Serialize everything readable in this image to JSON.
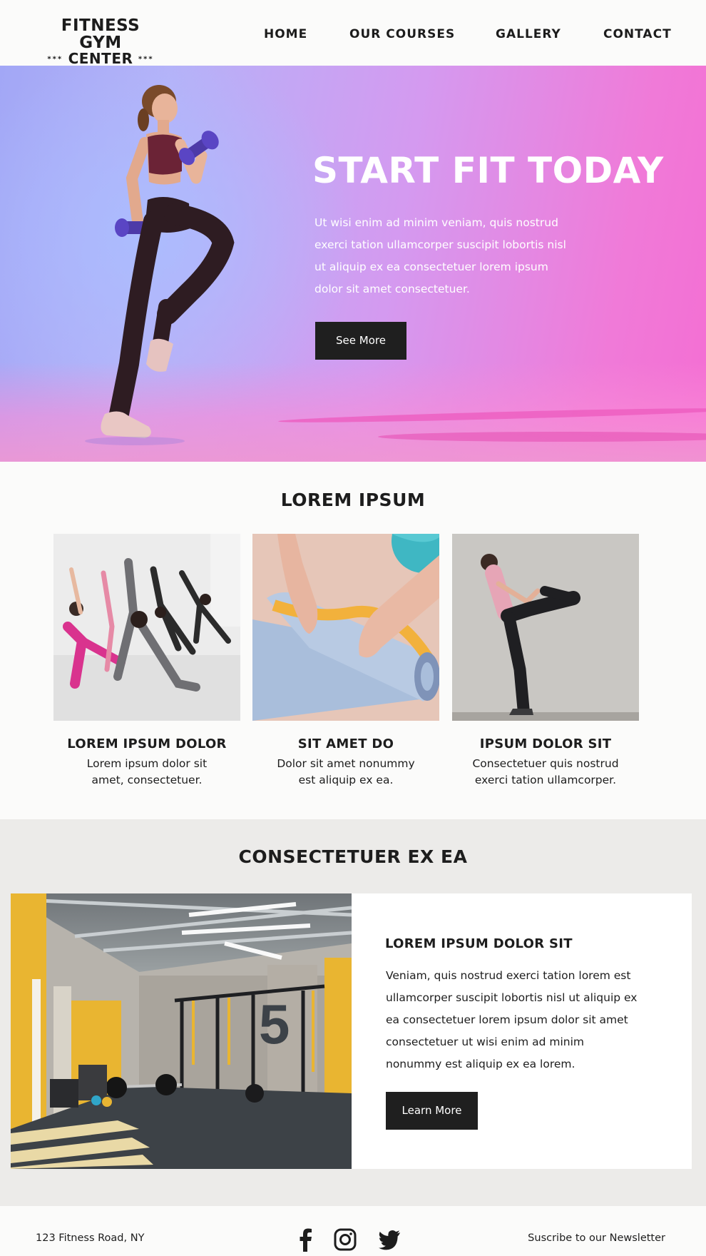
{
  "header": {
    "logo": {
      "line1": "FITNESS GYM",
      "stars": "***",
      "line2": "CENTER"
    },
    "nav": [
      "HOME",
      "OUR COURSES",
      "GALLERY",
      "CONTACT"
    ]
  },
  "hero": {
    "title": "START FIT TODAY",
    "text": "Ut wisi enim ad minim veniam, quis nostrud exerci tation ullamcorper suscipit lobortis nisl ut aliquip ex ea consectetuer lorem ipsum dolor sit amet consectetuer.",
    "button": "See More"
  },
  "features": {
    "title": "LOREM IPSUM",
    "cards": [
      {
        "title": "LOREM IPSUM DOLOR",
        "text": "Lorem ipsum dolor sit amet, consectetuer."
      },
      {
        "title": "SIT AMET DO",
        "text": "Dolor sit amet nonummy est aliquip ex ea."
      },
      {
        "title": "IPSUM DOLOR SIT",
        "text": "Consectetuer quis nostrud exerci tation ullamcorper."
      }
    ]
  },
  "promo": {
    "title": "CONSECTETUER EX EA",
    "heading": "LOREM IPSUM DOLOR SIT",
    "text": "Veniam, quis nostrud exerci tation lorem est ullamcorper suscipit lobortis nisl ut aliquip ex ea consectetuer lorem ipsum dolor sit amet consectetuer ut wisi enim ad minim nonummy est aliquip ex ea lorem.",
    "button": "Learn More",
    "gym_number": "5"
  },
  "footer": {
    "address": "123 Fitness Road, NY",
    "newsletter": "Suscribe to our Newsletter",
    "social": [
      "facebook-icon",
      "instagram-icon",
      "twitter-icon"
    ]
  },
  "colors": {
    "dark": "#1f1f1f",
    "hero_blue": "#a2a7f6",
    "hero_pink": "#f46ed3",
    "promo_band": "#ecebe9"
  }
}
